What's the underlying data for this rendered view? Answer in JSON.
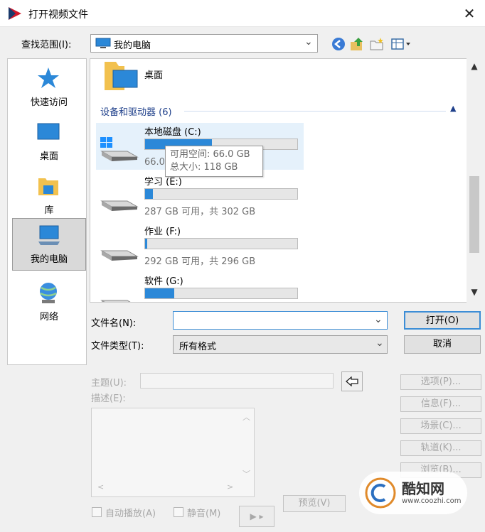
{
  "window": {
    "title": "打开视频文件",
    "close_glyph": "✕"
  },
  "look_in": {
    "label": "查找范围(I):",
    "value": "我的电脑"
  },
  "places": [
    {
      "label": "快速访问",
      "icon": "star-icon"
    },
    {
      "label": "桌面",
      "icon": "desktop-icon"
    },
    {
      "label": "库",
      "icon": "library-icon"
    },
    {
      "label": "我的电脑",
      "icon": "computer-icon",
      "selected": true
    },
    {
      "label": "网络",
      "icon": "network-icon"
    }
  ],
  "file_list": {
    "top_item": {
      "label": "桌面"
    },
    "group_header": "设备和驱动器 (6)",
    "drives": [
      {
        "name": "本地磁盘 (C:)",
        "info": "66.0 GB 可用，共 118 GB",
        "used_fraction": 0.44,
        "system": true
      },
      {
        "name": "学习 (E:)",
        "info": "287 GB 可用，共 302 GB",
        "used_fraction": 0.05
      },
      {
        "name": "作业 (F:)",
        "info": "292 GB 可用，共 296 GB",
        "used_fraction": 0.015
      },
      {
        "name": "软件 (G:)",
        "info": "",
        "used_fraction": 0.19
      }
    ],
    "tooltip": {
      "free": "可用空间: 66.0 GB",
      "total": "总大小: 118 GB"
    }
  },
  "filename": {
    "label": "文件名(N):",
    "value": ""
  },
  "filetype": {
    "label": "文件类型(T):",
    "value": "所有格式"
  },
  "buttons": {
    "open": "打开(O)",
    "cancel": "取消"
  },
  "meta": {
    "subject_label": "主题(U):",
    "desc_label": "描述(E):"
  },
  "side_buttons": [
    "选项(P)...",
    "信息(F)...",
    "场景(C)...",
    "轨道(K)...",
    "浏览(B)..."
  ],
  "checks": {
    "autoplay": "自动播放(A)",
    "mute": "静音(M)"
  },
  "preview_label": "预览(V)",
  "play_glyph": "▶ ▸",
  "watermark": {
    "text": "酷知网",
    "url": "www.coozhi.com"
  },
  "colors": {
    "accent": "#2b88d8",
    "group_header": "#1e3f8a",
    "logo_red": "#d0182b"
  }
}
